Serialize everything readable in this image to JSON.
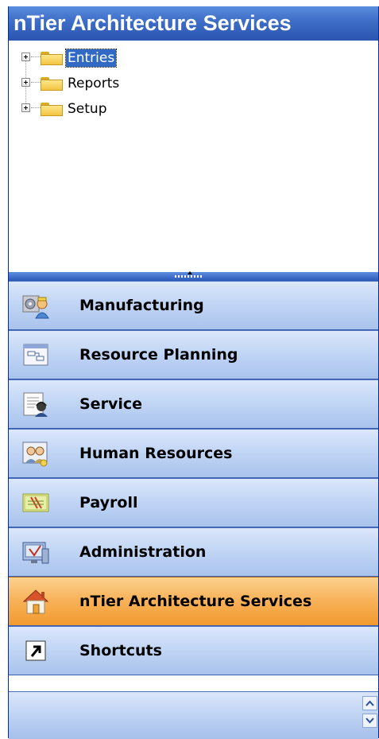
{
  "header": {
    "title": "nTier Architecture Services"
  },
  "tree": {
    "nodes": [
      {
        "label": "Entries",
        "selected": true,
        "icon": "folder-icon"
      },
      {
        "label": "Reports",
        "selected": false,
        "icon": "folder-icon"
      },
      {
        "label": "Setup",
        "selected": false,
        "icon": "folder-icon"
      }
    ]
  },
  "nav": {
    "items": [
      {
        "label": "Manufacturing",
        "icon": "manufacturing-icon",
        "active": false
      },
      {
        "label": "Resource Planning",
        "icon": "resource-planning-icon",
        "active": false
      },
      {
        "label": "Service",
        "icon": "service-icon",
        "active": false
      },
      {
        "label": "Human Resources",
        "icon": "human-resources-icon",
        "active": false
      },
      {
        "label": "Payroll",
        "icon": "payroll-icon",
        "active": false
      },
      {
        "label": "Administration",
        "icon": "administration-icon",
        "active": false
      },
      {
        "label": "nTier Architecture Services",
        "icon": "home-icon",
        "active": true
      },
      {
        "label": "Shortcuts",
        "icon": "shortcut-arrow-icon",
        "active": false
      }
    ]
  },
  "colors": {
    "header_blue": "#3f6fc8",
    "nav_blue": "#c2d6f5",
    "active_orange": "#f8b35c",
    "selection_blue": "#316ac5"
  }
}
